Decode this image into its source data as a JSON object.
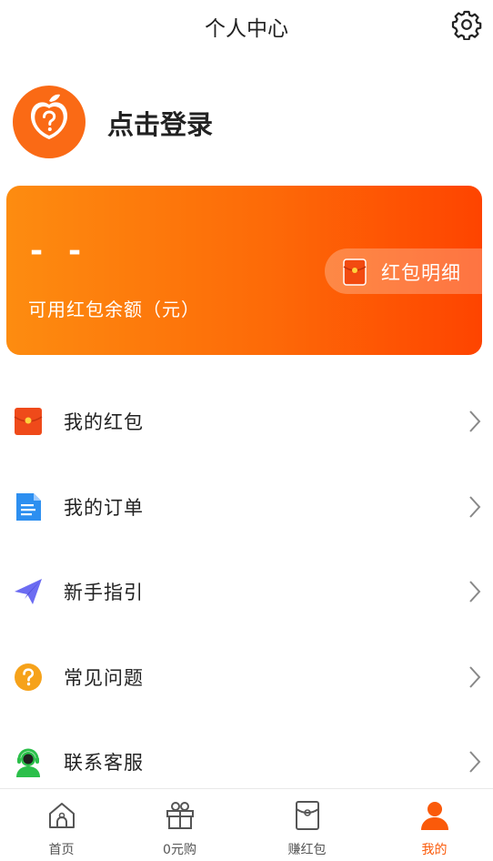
{
  "header": {
    "title": "个人中心",
    "settings_icon": "gear-icon"
  },
  "profile": {
    "login_text": "点击登录",
    "avatar_icon": "peach-question-icon"
  },
  "balance": {
    "value": "- -",
    "label": "可用红包余额（元）",
    "detail_label": "红包明细",
    "detail_icon": "red-envelope-icon"
  },
  "menu": [
    {
      "label": "我的红包",
      "icon": "red-envelope-icon"
    },
    {
      "label": "我的订单",
      "icon": "document-icon"
    },
    {
      "label": "新手指引",
      "icon": "paper-plane-icon"
    },
    {
      "label": "常见问题",
      "icon": "question-icon"
    },
    {
      "label": "联系客服",
      "icon": "customer-service-icon"
    }
  ],
  "tabs": [
    {
      "label": "首页",
      "icon": "home-icon",
      "active": false
    },
    {
      "label": "0元购",
      "icon": "gift-icon",
      "active": false
    },
    {
      "label": "赚红包",
      "icon": "envelope-icon",
      "active": false
    },
    {
      "label": "我的",
      "icon": "user-icon",
      "active": true
    }
  ],
  "colors": {
    "accent": "#fa5a0a",
    "card_start": "#fd8c10",
    "card_end": "#fe4400"
  }
}
